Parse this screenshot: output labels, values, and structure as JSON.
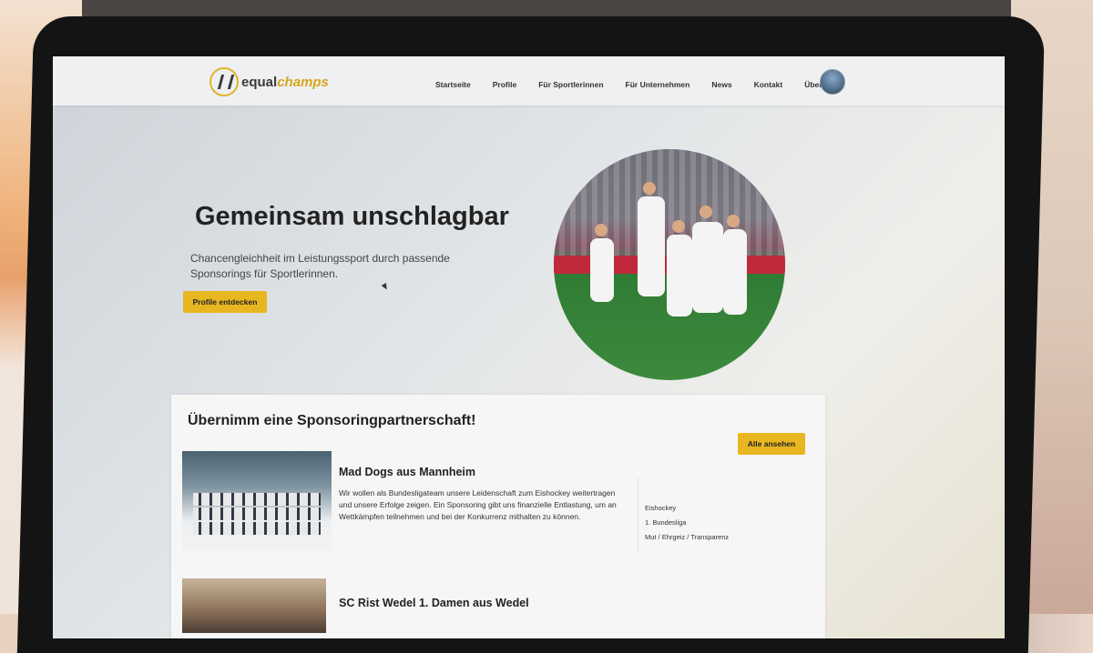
{
  "brand": {
    "part1": "equal",
    "part2": "champs"
  },
  "nav": {
    "items": [
      "Startseite",
      "Profile",
      "Für Sportlerinnen",
      "Für Unternehmen",
      "News",
      "Kontakt",
      "Über uns"
    ]
  },
  "hero": {
    "title": "Gemeinsam unschlagbar",
    "subtitle": "Chancengleichheit im Leistungssport durch passende Sponsorings für Sportlerinnen.",
    "button": "Profile entdecken"
  },
  "sponsoring": {
    "title": "Übernimm eine Sponsoringpartnerschaft!",
    "button": "Alle ansehen",
    "teams": [
      {
        "name": "Mad Dogs aus Mannheim",
        "description": "Wir wollen als Bundesligateam unsere Leidenschaft zum Eishockey weitertragen und unsere Erfolge zeigen. Ein Sponsoring gibt uns finanzielle Entlastung, um an Wettkämpfen teilnehmen und bei der Konkurrenz mithalten zu können.",
        "tags": [
          "Eishockey",
          "1. Bundesliga",
          "Mut / Ehrgeiz / Transparenz"
        ]
      },
      {
        "name": "SC Rist Wedel 1. Damen aus Wedel"
      }
    ]
  },
  "colors": {
    "accent": "#e8b621",
    "text": "#222222"
  }
}
